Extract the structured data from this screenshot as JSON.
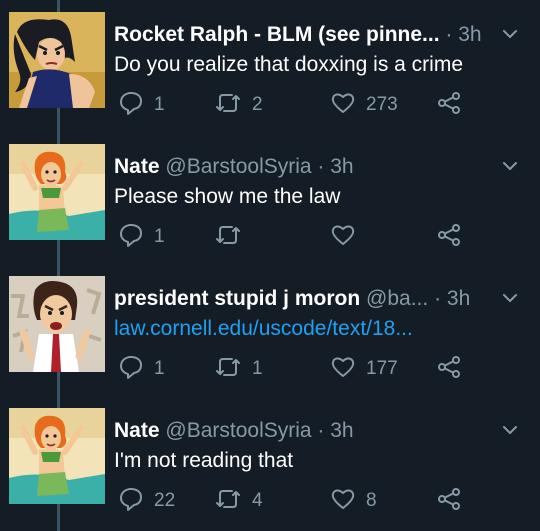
{
  "tweets": [
    {
      "name": "Rocket Ralph - BLM (see pinne...",
      "handle": "",
      "time": "· 3h",
      "text": "Do you realize that doxxing is a crime",
      "replies": "1",
      "retweets": "2",
      "likes": "273",
      "avatar": "dark-haired-cartoon-girl-avatar"
    },
    {
      "name": "Nate",
      "handle": "@BarstoolSyria",
      "time": "· 3h",
      "text": "Please show me the law",
      "replies": "1",
      "retweets": "",
      "likes": "",
      "avatar": "orange-haired-cartoon-girl-avatar"
    },
    {
      "name": "president stupid j moron",
      "handle": "@ba...",
      "time": "· 3h",
      "text": "law.cornell.edu/uscode/text/18...",
      "replies": "1",
      "retweets": "1",
      "likes": "177",
      "avatar": "angry-cartoon-man-avatar"
    },
    {
      "name": "Nate",
      "handle": "@BarstoolSyria",
      "time": "· 3h",
      "text": "I'm not reading that",
      "replies": "22",
      "retweets": "4",
      "likes": "8",
      "avatar": "orange-haired-cartoon-girl-avatar"
    }
  ],
  "colors": {
    "background": "#141d26",
    "secondary_text": "#8899a6",
    "link": "#1da1f2",
    "thread_line": "#3d5466"
  },
  "icons": [
    "reply-icon",
    "retweet-icon",
    "like-icon",
    "share-icon",
    "caret-down-icon"
  ]
}
